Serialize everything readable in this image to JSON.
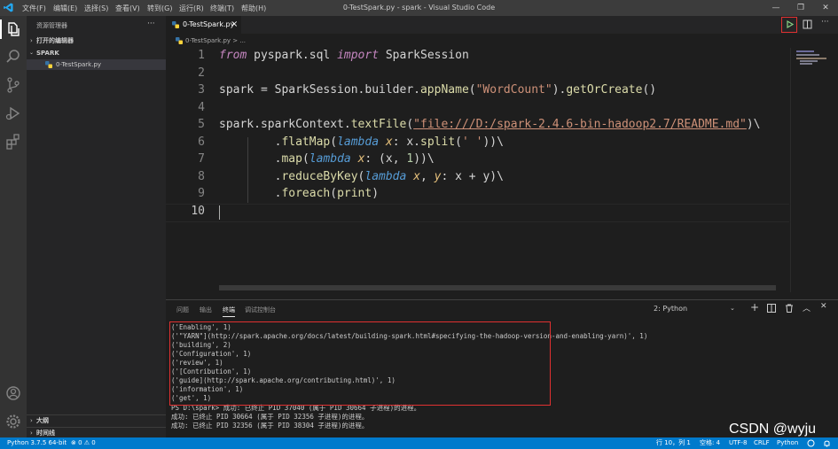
{
  "titlebar": {
    "menu": [
      "文件(F)",
      "编辑(E)",
      "选择(S)",
      "查看(V)",
      "转到(G)",
      "运行(R)",
      "终端(T)",
      "帮助(H)"
    ],
    "title": "0-TestSpark.py - spark - Visual Studio Code"
  },
  "sidebar": {
    "header": "资源管理器",
    "more": "···",
    "open_editors": "打开的编辑器",
    "folder": "SPARK",
    "file": "0-TestSpark.py",
    "outline": "大纲",
    "timeline": "时间线"
  },
  "editor": {
    "tab_label": "0-TestSpark.py",
    "tab_close": "×",
    "breadcrumb": "0-TestSpark.py > ...",
    "line_numbers": [
      "1",
      "2",
      "3",
      "4",
      "5",
      "6",
      "7",
      "8",
      "9",
      "10"
    ],
    "code": {
      "l1": [
        "from",
        " pyspark.sql ",
        "import",
        " SparkSession"
      ],
      "l3": [
        "spark",
        " = SparkSession.builder.",
        "appName",
        "(",
        "\"WordCount\"",
        ").",
        "getOrCreate",
        "()"
      ],
      "l5": [
        "spark.sparkContext.",
        "textFile",
        "(",
        "\"file:///D:/spark-2.4.6-bin-hadoop2.7/README.md\"",
        ")\\"
      ],
      "l6": [
        "        .",
        "flatMap",
        "(",
        "lambda",
        " ",
        "x",
        ": x.",
        "split",
        "(",
        "' '",
        "))\\"
      ],
      "l7": [
        "        .",
        "map",
        "(",
        "lambda",
        " ",
        "x",
        ": (x, ",
        "1",
        "))\\"
      ],
      "l8": [
        "        .",
        "reduceByKey",
        "(",
        "lambda",
        " ",
        "x",
        ", ",
        "y",
        ": x + y)\\"
      ],
      "l9": [
        "        .",
        "foreach",
        "(",
        "print",
        ")"
      ]
    }
  },
  "panel": {
    "tabs": [
      "问题",
      "输出",
      "终端",
      "调试控制台"
    ],
    "terminal_select": "2: Python",
    "output": [
      "('Enabling', 1)",
      "('\"YARN\"](http://spark.apache.org/docs/latest/building-spark.html#specifying-the-hadoop-version-and-enabling-yarn)', 1)",
      "('building', 2)",
      "('Configuration', 1)",
      "('review', 1)",
      "('[Contribution', 1)",
      "('guide](http://spark.apache.org/contributing.html)', 1)",
      "('information', 1)",
      "('get', 1)",
      "PS D:\\spark> 成功: 已终止 PID 37040 (属于 PID 30664 子进程)的进程。",
      "成功: 已终止 PID 30664 (属于 PID 32356 子进程)的进程。",
      "成功: 已终止 PID 32356 (属于 PID 38304 子进程)的进程。"
    ]
  },
  "statusbar": {
    "python": "Python 3.7.5 64-bit",
    "problems": "⊗ 0 ⚠ 0",
    "position": "行 10，列 1",
    "spaces": "空格: 4",
    "encoding": "UTF-8",
    "eol": "CRLF",
    "language": "Python"
  },
  "watermark": "CSDN @wyju",
  "colors": {
    "accent": "#007acc",
    "highlight_box": "#e03131"
  }
}
